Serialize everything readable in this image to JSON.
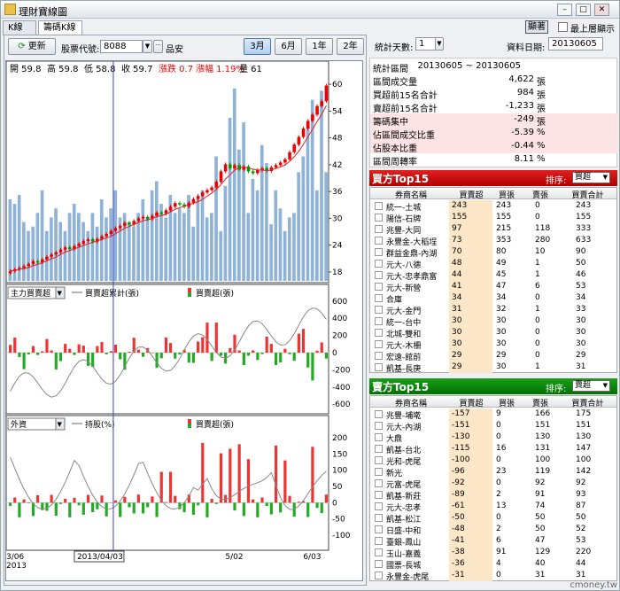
{
  "window": {
    "title": "理財寶線圖"
  },
  "tabs": [
    {
      "label": "K線圖"
    },
    {
      "label": "籌碼K線圖"
    }
  ],
  "top_right": {
    "button": "顯著",
    "checkbox_label": "最上層顯示"
  },
  "toolbar": {
    "refresh": "更新",
    "stock_code_label": "股票代號:",
    "stock_code": "8088",
    "stock_name": "品安",
    "ranges": [
      "3月",
      "6月",
      "1年",
      "2年"
    ],
    "selected_range": "3月"
  },
  "ohlc": {
    "open": "開 59.8",
    "high": "高 59.8",
    "low": "低 58.8",
    "close": "收 59.7",
    "change_label": "漲跌 0.7",
    "pct_label": "漲幅 1.19%",
    "vol_label": "量 61"
  },
  "chart_data": [
    {
      "type": "candlestick",
      "title": "",
      "ylim": [
        16,
        62
      ],
      "yticks": [
        18,
        24,
        30,
        36,
        42,
        48,
        54,
        60
      ],
      "close": [
        18.2,
        18.6,
        18.9,
        19.3,
        19.8,
        20.4,
        20.1,
        20.8,
        21.4,
        21.9,
        22.4,
        23,
        23.5,
        23.1,
        23.8,
        24.3,
        24.9,
        25.3,
        24.8,
        25.4,
        26,
        26.5,
        27.2,
        27.8,
        28.3,
        29,
        28.6,
        29.4,
        30,
        30.3,
        29.8,
        30.6,
        31.3,
        31,
        31.8,
        32.6,
        33.4,
        33.1,
        32.6,
        33.5,
        34.3,
        35,
        35.8,
        36.3,
        36.9,
        38.2,
        40.5,
        42.1,
        41.2,
        41.9,
        40.9,
        41.6,
        40.5,
        40.1,
        40.8,
        41.2,
        40.6,
        41.4,
        41.9,
        42.5,
        43.2,
        44.8,
        46.5,
        48.2,
        50.1,
        51.8,
        53.2,
        55.1,
        56.2,
        59.7
      ],
      "volume": [
        36,
        34,
        38,
        26,
        22,
        24,
        30,
        40,
        22,
        28,
        32,
        26,
        22,
        30,
        34,
        30,
        26,
        22,
        30,
        24,
        36,
        28,
        32,
        40,
        28,
        30,
        26,
        24,
        30,
        36,
        28,
        40,
        44,
        34,
        28,
        38,
        30,
        32,
        30,
        38,
        24,
        36,
        40,
        28,
        30,
        55,
        22,
        42,
        72,
        85,
        58,
        70,
        30,
        45,
        40,
        60,
        52,
        25,
        40,
        32,
        22,
        28,
        30,
        48,
        55,
        70,
        80,
        40,
        84,
        48
      ]
    },
    {
      "type": "bar",
      "title": "主力買賣超",
      "legend": [
        "買賣超累計(張)",
        "買賣超(張)"
      ],
      "ylim": [
        -650,
        650
      ],
      "yticks": [
        600,
        400,
        200,
        0,
        -200,
        -400,
        -600
      ]
    },
    {
      "type": "bar",
      "title": "外資",
      "legend": [
        "持股(%)",
        "買賣超(張)"
      ],
      "ylim": [
        -130,
        230
      ],
      "yticks": [
        200,
        150,
        100,
        50,
        0,
        -50,
        -100
      ]
    }
  ],
  "xaxis": {
    "labels": [
      "3/06",
      "5/02",
      "6/03"
    ],
    "year": "2013",
    "cursor_date": "2013/04/03"
  },
  "stats": {
    "days_label": "統計天數:",
    "days": "1",
    "date_label": "資料日期:",
    "date": "20130605",
    "rows": [
      {
        "k": "統計區間",
        "v": "20130605 ~ 20130605",
        "u": ""
      },
      {
        "k": "區間成交量",
        "v": "4,622",
        "u": "張"
      },
      {
        "k": "買超前15名合計",
        "v": "984",
        "u": "張"
      },
      {
        "k": "賣超前15名合計",
        "v": "-1,233",
        "u": "張"
      },
      {
        "k": "籌碼集中",
        "v": "-249",
        "u": "張"
      },
      {
        "k": "佔區間成交比重",
        "v": "-5.39",
        "u": "%"
      },
      {
        "k": "佔股本比重",
        "v": "-0.44",
        "u": "%"
      },
      {
        "k": "區間周轉率",
        "v": "8.11",
        "u": "%"
      }
    ]
  },
  "buy_table": {
    "title": "買方Top15",
    "sort_label": "排序:",
    "sort_value": "買超",
    "headers": [
      "券商名稱",
      "買賣超",
      "買張",
      "賣張",
      "買賣合計"
    ],
    "rows": [
      [
        "統一-土城",
        "243",
        "243",
        "0",
        "243"
      ],
      [
        "陽信-石牌",
        "155",
        "155",
        "0",
        "155"
      ],
      [
        "兆豐-大同",
        "97",
        "215",
        "118",
        "333"
      ],
      [
        "永豐金-大稻埕",
        "73",
        "353",
        "280",
        "633"
      ],
      [
        "群益金鼎-內湖",
        "70",
        "80",
        "10",
        "90"
      ],
      [
        "元大-八德",
        "48",
        "49",
        "1",
        "50"
      ],
      [
        "元大-忠孝鼎富",
        "44",
        "45",
        "1",
        "46"
      ],
      [
        "元大-新營",
        "41",
        "47",
        "6",
        "53"
      ],
      [
        "合庫",
        "34",
        "34",
        "0",
        "34"
      ],
      [
        "元大-金門",
        "31",
        "32",
        "1",
        "33"
      ],
      [
        "統一-台中",
        "30",
        "30",
        "0",
        "30"
      ],
      [
        "北城-雙和",
        "30",
        "30",
        "0",
        "30"
      ],
      [
        "元大-木柵",
        "30",
        "30",
        "0",
        "30"
      ],
      [
        "宏遠-館前",
        "29",
        "29",
        "0",
        "29"
      ],
      [
        "凱基-長庚",
        "29",
        "30",
        "1",
        "31"
      ]
    ]
  },
  "sell_table": {
    "title": "賣方Top15",
    "sort_label": "排序:",
    "sort_value": "賣超",
    "headers": [
      "券商名稱",
      "買賣超",
      "買張",
      "賣張",
      "買賣合計"
    ],
    "rows": [
      [
        "兆豐-埔墘",
        "-157",
        "9",
        "166",
        "175"
      ],
      [
        "元大-內湖",
        "-151",
        "0",
        "151",
        "151"
      ],
      [
        "大鼎",
        "-130",
        "0",
        "130",
        "130"
      ],
      [
        "凱基-台北",
        "-115",
        "16",
        "131",
        "147"
      ],
      [
        "光和-虎尾",
        "-100",
        "0",
        "100",
        "100"
      ],
      [
        "新光",
        "-96",
        "23",
        "119",
        "142"
      ],
      [
        "元富-虎尾",
        "-92",
        "0",
        "92",
        "92"
      ],
      [
        "凱基-新莊",
        "-89",
        "2",
        "91",
        "93"
      ],
      [
        "元大-忠孝",
        "-61",
        "13",
        "74",
        "87"
      ],
      [
        "凱基-松江",
        "-50",
        "0",
        "50",
        "50"
      ],
      [
        "日盛-中和",
        "-48",
        "2",
        "50",
        "52"
      ],
      [
        "臺銀-鳳山",
        "-41",
        "6",
        "47",
        "53"
      ],
      [
        "玉山-嘉義",
        "-38",
        "91",
        "129",
        "220"
      ],
      [
        "國票-長城",
        "-36",
        "4",
        "40",
        "44"
      ],
      [
        "永豐金-虎尾",
        "-31",
        "0",
        "31",
        "31"
      ]
    ]
  },
  "watermark": "cmoney.tw"
}
